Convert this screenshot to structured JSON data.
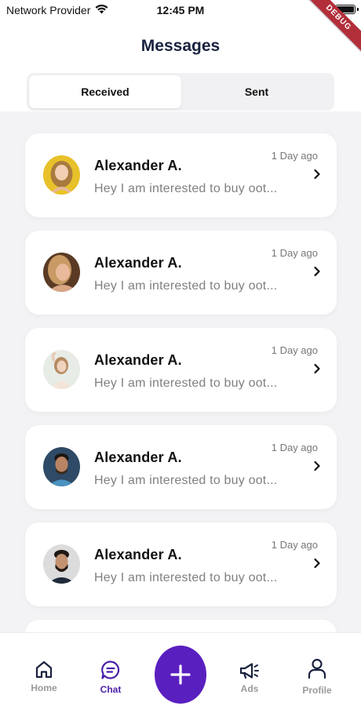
{
  "status_bar": {
    "carrier": "Network Provider",
    "time": "12:45 PM"
  },
  "debug_banner": "DEBUG",
  "header": {
    "title": "Messages"
  },
  "tabs": [
    {
      "label": "Received",
      "selected": true
    },
    {
      "label": "Sent",
      "selected": false
    }
  ],
  "messages": [
    {
      "name": "Alexander A.",
      "preview": "Hey I am interested to buy oot...",
      "time": "1 Day ago",
      "avatar": "avatar-woman-yellow"
    },
    {
      "name": "Alexander A.",
      "preview": "Hey I am interested to buy oot...",
      "time": "1 Day ago",
      "avatar": "avatar-woman-blonde"
    },
    {
      "name": "Alexander A.",
      "preview": "Hey I am interested to buy oot...",
      "time": "1 Day ago",
      "avatar": "avatar-woman-light"
    },
    {
      "name": "Alexander A.",
      "preview": "Hey I am interested to buy oot...",
      "time": "1 Day ago",
      "avatar": "avatar-man-blue"
    },
    {
      "name": "Alexander A.",
      "preview": "Hey I am interested to buy oot...",
      "time": "1 Day ago",
      "avatar": "avatar-man-beard"
    }
  ],
  "bottom_nav": {
    "home": "Home",
    "chat": "Chat",
    "add": "add-icon",
    "ads": "Ads",
    "profile": "Profile",
    "active": "Chat"
  },
  "colors": {
    "accent": "#5a1fbf",
    "title": "#1a2240",
    "debug": "#b22f3a"
  }
}
